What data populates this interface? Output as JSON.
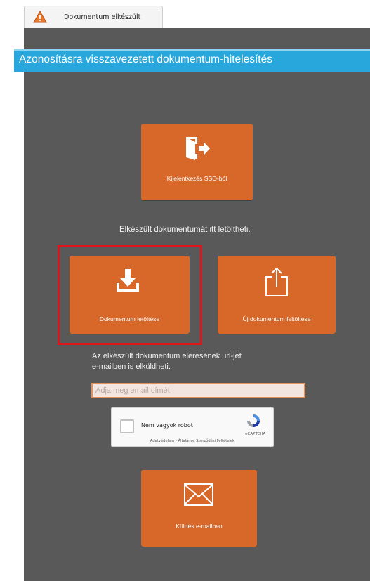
{
  "tab": {
    "label": "Dokumentum elkészült",
    "icon": "warning-icon"
  },
  "header": {
    "title": "Azonosításra visszavezetett dokumentum-hitelesítés"
  },
  "logout_tile": {
    "label": "Kijelentkezés SSO-ból",
    "icon": "logout-door-icon"
  },
  "info_text": "Elkészült dokumentumát itt letöltheti.",
  "download_tile": {
    "label": "Dokumentum letöltése",
    "icon": "download-icon"
  },
  "upload_tile": {
    "label": "Új dokumentum feltöltése",
    "icon": "upload-icon"
  },
  "email_text": {
    "line1": "Az elkészült dokumentum elérésének url-jét",
    "line2": "e-mailben is elküldheti."
  },
  "email_input": {
    "placeholder": "Adja meg email címét",
    "value": ""
  },
  "captcha": {
    "label": "Nem vagyok robot",
    "brand": "reCAPTCHA",
    "terms": "Adatvédelem - Általános Szerződési Feltételek"
  },
  "send_tile": {
    "label": "Küldés e-mailben",
    "icon": "envelope-icon"
  },
  "colors": {
    "accent": "#d8682a",
    "header": "#27a7dc",
    "panel": "#595959",
    "highlight": "#e0141c"
  }
}
